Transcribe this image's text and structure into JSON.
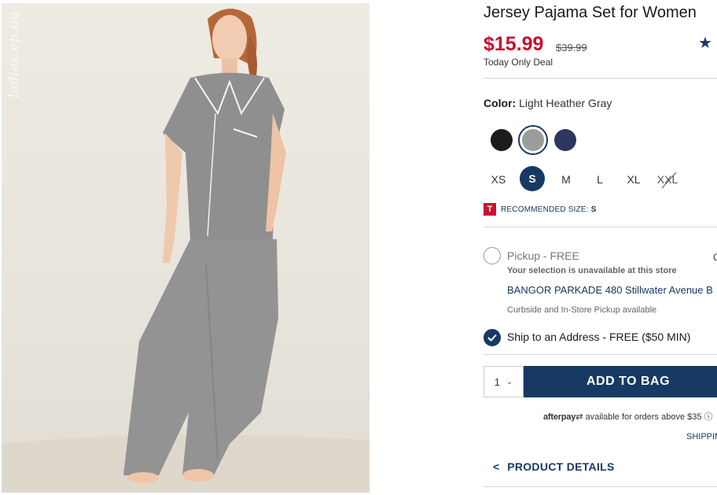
{
  "product": {
    "title": "Jersey Pajama Set for Women",
    "price": "$15.99",
    "old_price": "$39.99",
    "deal": "Today Only Deal",
    "rating_icon": "star-icon"
  },
  "photo": {
    "watermark": "ladies.ep.uu"
  },
  "color": {
    "label": "Color:",
    "value": "Light Heather Gray",
    "swatches": [
      {
        "name": "black",
        "hex": "#1c1c1c"
      },
      {
        "name": "light-heather-gray",
        "hex": "#9c9c9c",
        "selected": true
      },
      {
        "name": "navy",
        "hex": "#2d3561"
      }
    ]
  },
  "sizes": [
    {
      "label": "XS"
    },
    {
      "label": "S",
      "selected": true
    },
    {
      "label": "M"
    },
    {
      "label": "L"
    },
    {
      "label": "XL"
    },
    {
      "label": "XXL",
      "unavailable": true
    }
  ],
  "recommended": {
    "badge": "T",
    "label": "RECOMMENDED SIZE:",
    "value": "S"
  },
  "fulfillment": {
    "pickup_label": "Pickup - FREE",
    "pickup_note": "Your selection is unavailable at this store",
    "store": "BANGOR PARKADE 480 Stillwater Avenue",
    "store_extra": "C",
    "store_tail": "B",
    "curbside": "Curbside and In-Store Pickup available",
    "ship_label": "Ship to an Address - FREE ($50 MIN)"
  },
  "cart": {
    "quantity": "1",
    "add_label": "ADD TO BAG"
  },
  "afterpay": {
    "brand": "afterpay",
    "text": "available for orders above $35"
  },
  "shipping_link": "SHIPPIN",
  "details_label": "PRODUCT DETAILS",
  "colors": {
    "price_red": "#c8102e",
    "navy": "#163a63"
  }
}
